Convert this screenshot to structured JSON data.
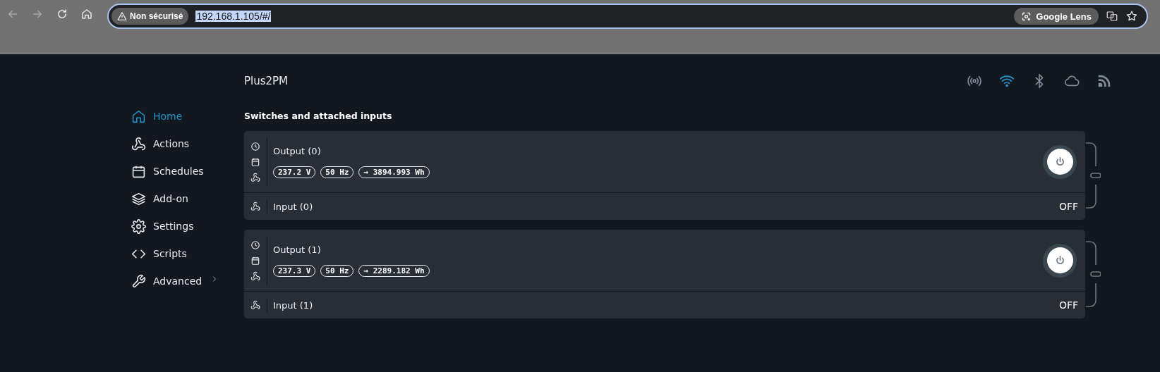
{
  "browser": {
    "security_label": "Non sécurisé",
    "url": "192.168.1.105/#/",
    "lens_label": "Google Lens"
  },
  "sidebar": {
    "items": [
      {
        "label": "Home",
        "kind": "home",
        "selected": true
      },
      {
        "label": "Actions",
        "kind": "actions",
        "selected": false
      },
      {
        "label": "Schedules",
        "kind": "schedules",
        "selected": false
      },
      {
        "label": "Add-on",
        "kind": "addon",
        "selected": false
      },
      {
        "label": "Settings",
        "kind": "settings",
        "selected": false
      },
      {
        "label": "Scripts",
        "kind": "scripts",
        "selected": false
      },
      {
        "label": "Advanced",
        "kind": "advanced",
        "selected": false,
        "has_submenu": true
      }
    ]
  },
  "header": {
    "device_name": "Plus2PM",
    "status_icons": [
      {
        "kind": "ap",
        "active": false
      },
      {
        "kind": "wifi",
        "active": true
      },
      {
        "kind": "bluetooth",
        "active": false
      },
      {
        "kind": "cloud",
        "active": false
      },
      {
        "kind": "mqtt",
        "active": false
      }
    ]
  },
  "section_title": "Switches and attached inputs",
  "switches": [
    {
      "output": {
        "name": "Output (0)",
        "on": false,
        "readings": [
          "237.2 V",
          "50 Hz",
          "→ 3894.993 Wh"
        ]
      },
      "input": {
        "name": "Input (0)",
        "state": "OFF"
      }
    },
    {
      "output": {
        "name": "Output (1)",
        "on": false,
        "readings": [
          "237.3 V",
          "50 Hz",
          "→ 2289.182 Wh"
        ]
      },
      "input": {
        "name": "Input (1)",
        "state": "OFF"
      }
    }
  ]
}
